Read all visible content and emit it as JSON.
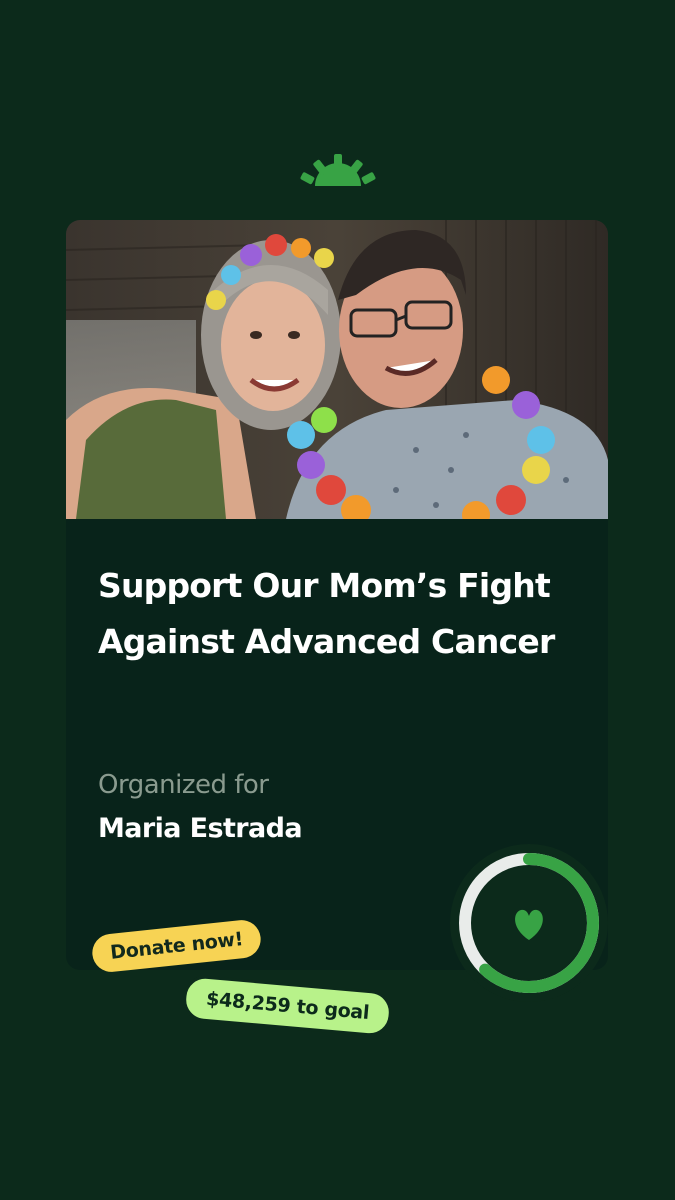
{
  "logo": {
    "icon": "sunrise-logo-icon"
  },
  "campaign": {
    "photo_alt": "Photo of a smiling couple wearing colorful flower leis",
    "title": "Support Our Mom’s Fight Against Advanced Cancer",
    "organized_label": "Organized for",
    "organized_for": "Maria Estrada"
  },
  "progress": {
    "fraction": 0.62,
    "icon": "heart-icon"
  },
  "cta": {
    "donate_label": "Donate now!",
    "goal_label": "$48,259 to goal"
  },
  "colors": {
    "background": "#0c2a1b",
    "card": "#08231a",
    "brand_green": "#38a345",
    "donate_pill": "#f7d354",
    "goal_pill": "#b8f28a"
  }
}
